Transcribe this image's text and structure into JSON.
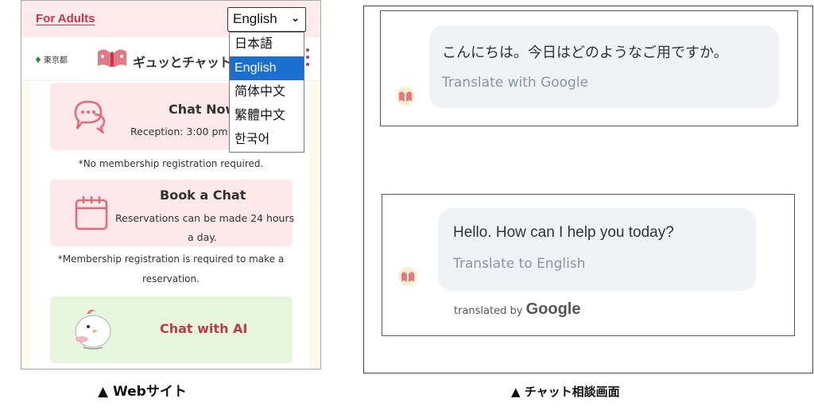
{
  "website": {
    "for_adults": "For Adults",
    "language_select": {
      "value": "English"
    },
    "language_options": [
      "日本語",
      "English",
      "简体中文",
      "繁體中文",
      "한국어"
    ],
    "tokyo_label": "東京都",
    "logo_text": "ギュッとチャット",
    "cards": {
      "chat_now": {
        "title": "Chat Now",
        "subtitle": "Reception: 3:00 pm"
      },
      "book_chat": {
        "title": "Book a Chat",
        "subtitle_line1": "Reservations can be made 24 hours",
        "subtitle_line2": "a day."
      },
      "chat_ai": {
        "title": "Chat with AI"
      }
    },
    "notes": {
      "no_membership": "*No membership registration required.",
      "membership_line1": "*Membership registration is required to make a",
      "membership_line2": "reservation."
    }
  },
  "chat_screen": {
    "message_ja": "こんにちは。今日はどのようなご用ですか。",
    "translate_google": "Translate with Google",
    "message_en": "Hello. How can I help you today?",
    "translate_english": "Translate to English",
    "translated_by": "translated by",
    "google_brand": "Google"
  },
  "captions": {
    "left": "▲ Webサイト",
    "right": "▲ チャット相談画面"
  },
  "colors": {
    "brand_red": "#c0384b",
    "pink_card": "#fde9e9",
    "green_card": "#e6f7de",
    "select_blue": "#1a6fd1",
    "topbar": "#fdeaea"
  }
}
